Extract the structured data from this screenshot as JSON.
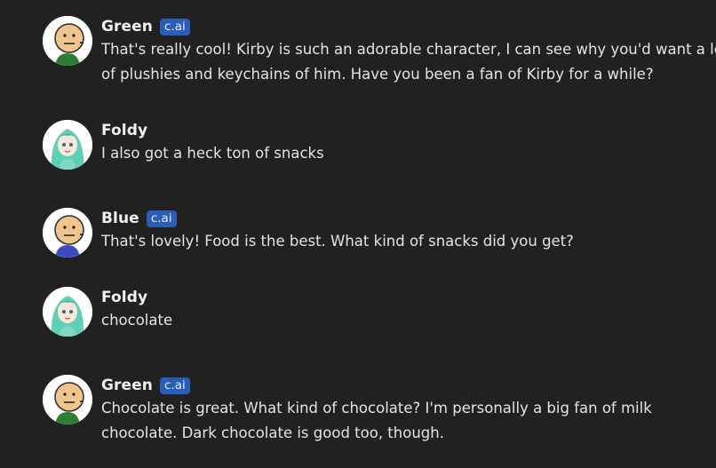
{
  "messages": [
    {
      "author": "Green",
      "badge": "c.ai",
      "avatar_icon": "cyanide-happiness-green-avatar-icon",
      "line1": "That's really cool! Kirby is such an adorable character, I can see why you'd want a lot",
      "line2": "of plushies and keychains of him. Have you been a fan of Kirby for a while?"
    },
    {
      "author": "Foldy",
      "avatar_icon": "anime-teal-hair-avatar-icon",
      "line1": "I also got a heck ton of snacks"
    },
    {
      "author": "Blue",
      "badge": "c.ai",
      "avatar_icon": "cyanide-happiness-blue-avatar-icon",
      "line1": "That's lovely! Food is the best. What kind of snacks did you get?"
    },
    {
      "author": "Foldy",
      "avatar_icon": "anime-teal-hair-avatar-icon",
      "line1": "chocolate"
    },
    {
      "author": "Green",
      "badge": "c.ai",
      "avatar_icon": "cyanide-happiness-green-avatar-icon",
      "line1": "Chocolate is great. What kind of chocolate? I'm personally a big fan of milk",
      "line2": "chocolate. Dark chocolate is good too, though."
    }
  ],
  "colors": {
    "background": "#212121",
    "badge": "#2a5db7",
    "text": "#e4e4e4",
    "green_shirt": "#2e7d32",
    "blue_shirt": "#3b4cc0",
    "teal_hair": "#5fcfb6"
  }
}
